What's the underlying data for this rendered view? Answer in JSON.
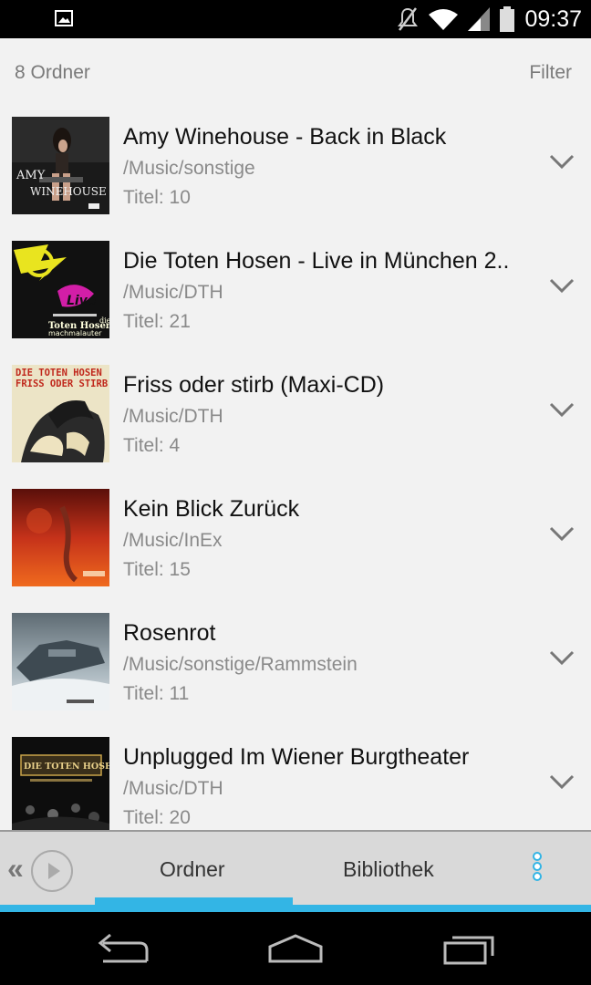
{
  "statusbar": {
    "time": "09:37",
    "icons": [
      "image-notification-icon",
      "mute-icon",
      "wifi-icon",
      "signal-icon",
      "battery-icon"
    ]
  },
  "header": {
    "folder_count": "8 Ordner",
    "filter_label": "Filter"
  },
  "folders": [
    {
      "title": "Amy Winehouse - Back in Black",
      "path": "/Music/sonstige",
      "tracks": "Titel: 10"
    },
    {
      "title": "Die Toten Hosen - Live in München 2..",
      "path": "/Music/DTH",
      "tracks": "Titel: 21"
    },
    {
      "title": "Friss oder stirb (Maxi-CD)",
      "path": "/Music/DTH",
      "tracks": "Titel: 4"
    },
    {
      "title": "Kein Blick Zurück",
      "path": "/Music/InEx",
      "tracks": "Titel: 15"
    },
    {
      "title": "Rosenrot",
      "path": "/Music/sonstige/Rammstein",
      "tracks": "Titel: 11"
    },
    {
      "title": "Unplugged Im Wiener Burgtheater",
      "path": "/Music/DTH",
      "tracks": "Titel: 20"
    }
  ],
  "covers": {
    "amy_line1": "AMY",
    "amy_line2": "WINEHOUSE",
    "dth_live_line1": "die",
    "dth_live_line2": "Toten Hosen",
    "dth_live_line3": "machmalauter",
    "friss_line1": "DIE TOTEN HOSEN",
    "friss_line2": "FRISS ODER STIRB",
    "unplugged_line1": "DIE TOTEN HOSEN"
  },
  "tabbar": {
    "tab_ordner": "Ordner",
    "tab_bibliothek": "Bibliothek",
    "back_glyph": "«",
    "active_tab": "Ordner",
    "accent_color": "#33b5e5"
  },
  "navbar": {
    "icons": [
      "back-icon",
      "home-icon",
      "recent-apps-icon"
    ]
  }
}
